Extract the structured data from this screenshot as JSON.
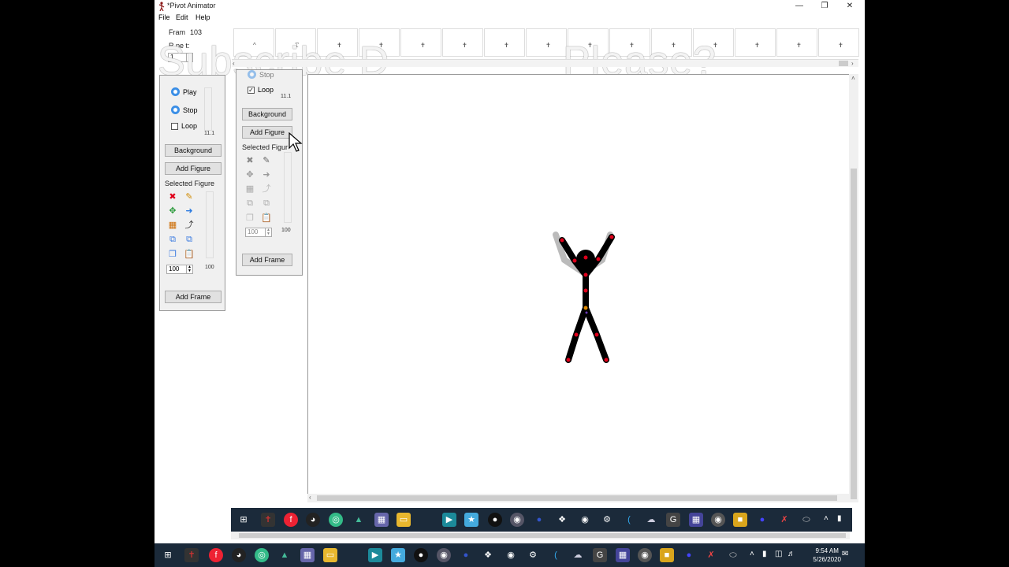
{
  "window": {
    "title": "*Pivot Animator"
  },
  "menu": [
    "File",
    "Edit",
    "Help"
  ],
  "frame_info": {
    "frame_label": "Fram",
    "frame_value": "103",
    "repeat_label": "R pe t:",
    "repeat_value": "1"
  },
  "watermark": {
    "left": "Subscribe D",
    "right": "Please?"
  },
  "panel_left": {
    "play": "Play",
    "stop": "Stop",
    "loop": "Loop",
    "speed": "11.1",
    "background": "Background",
    "add_figure": "Add Figure",
    "selected_figure": "Selected Figure",
    "size_value": "100",
    "size_max": "100",
    "add_frame": "Add Frame"
  },
  "panel_right": {
    "stop": "Stop",
    "loop": "Loop",
    "speed": "11.1",
    "background": "Background",
    "add_figure": "Add Figure",
    "selected_figure": "Selected Figur",
    "size_value": "100",
    "size_max": "100",
    "add_frame": "Add Frame"
  },
  "taskbar": {
    "time": "9:54 AM",
    "date": "5/26/2020"
  },
  "colors": {
    "taskbar": "#1b2a3a",
    "accent": "#3a8ee6",
    "joint": "#e0001b",
    "figure": "#000000"
  }
}
